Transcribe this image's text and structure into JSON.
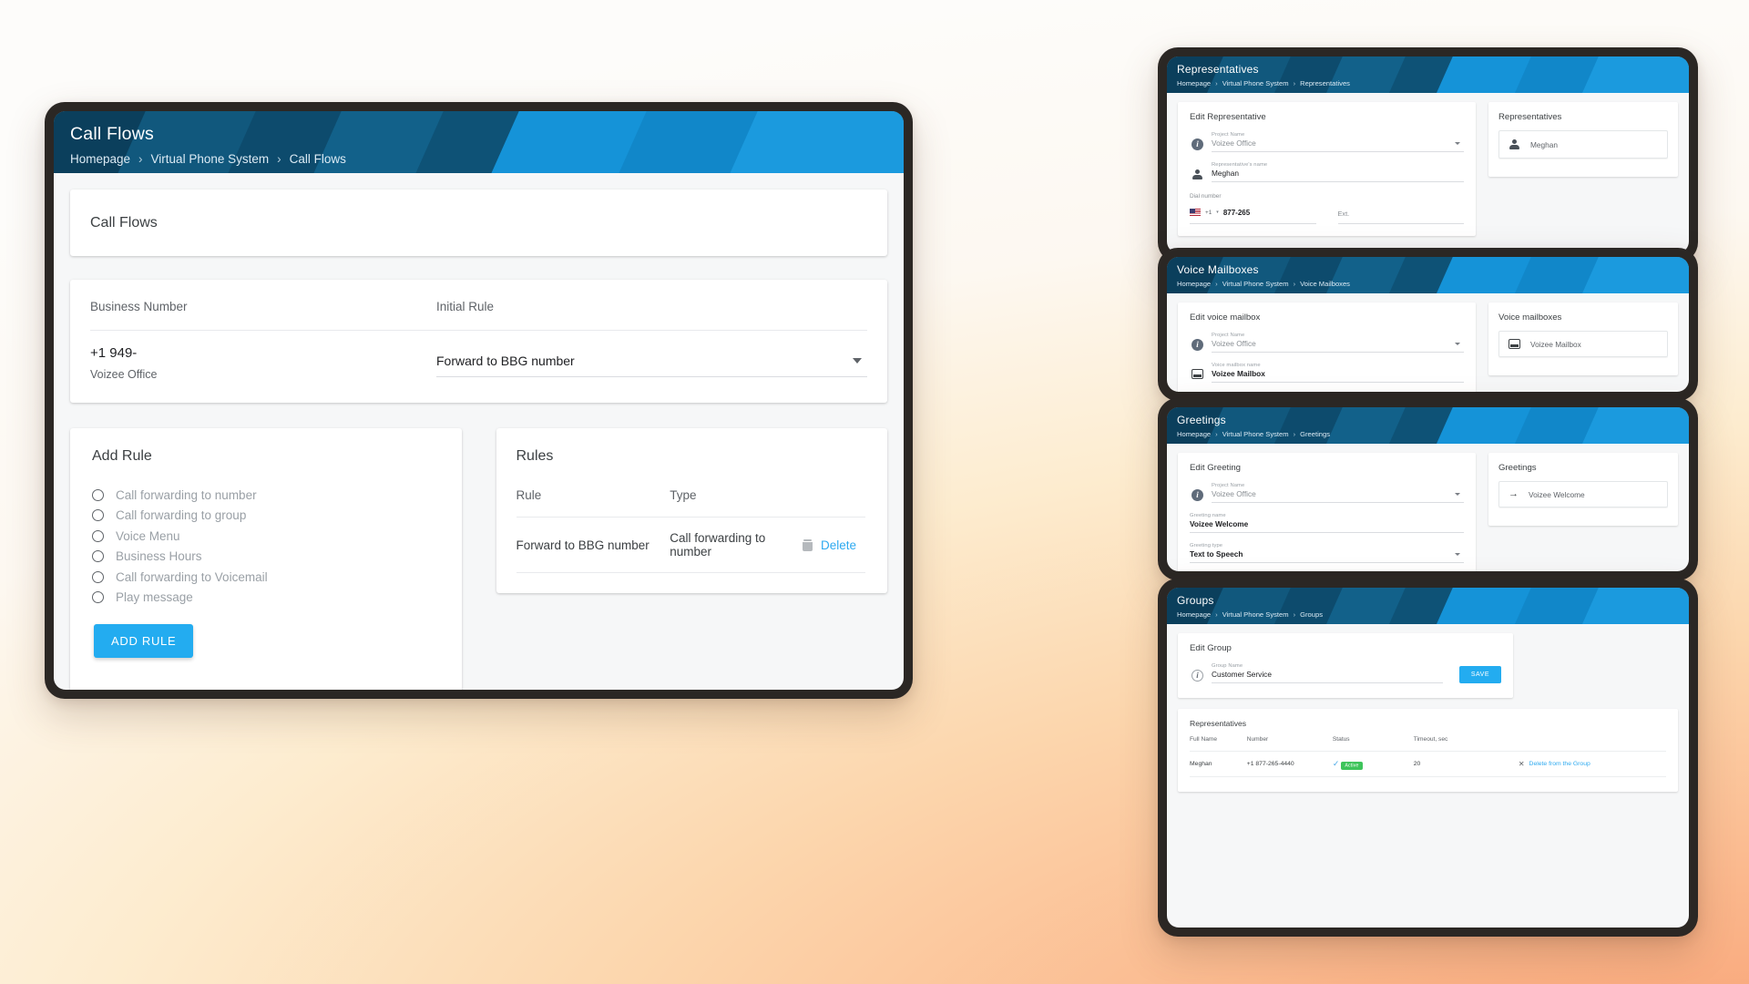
{
  "theme": {
    "accent": "#23acf0",
    "banner_dark": "#0c4a6b",
    "banner_light": "#1593d8",
    "link": "#2eaaf0",
    "status_green": "#3ec45b",
    "bg_warm": "#f79b6e"
  },
  "main": {
    "banner": {
      "title": "Call Flows",
      "breadcrumb": [
        "Homepage",
        "Virtual Phone System",
        "Call Flows"
      ],
      "separator": "›"
    },
    "page_title": "Call Flows",
    "number_section": {
      "col_business_number": "Business Number",
      "col_initial_rule": "Initial Rule",
      "number": "+1 949-",
      "project": "Voizee Office",
      "initial_rule_value": "Forward to BBG number"
    },
    "add_rule": {
      "title": "Add Rule",
      "options": [
        "Call forwarding to number",
        "Call forwarding to group",
        "Voice Menu",
        "Business Hours",
        "Call forwarding to Voicemail",
        "Play message"
      ],
      "button": "ADD RULE"
    },
    "rules": {
      "title": "Rules",
      "columns": [
        "Rule",
        "Type",
        ""
      ],
      "rows": [
        {
          "rule": "Forward to BBG number",
          "type": "Call forwarding to number",
          "action": "Delete"
        }
      ]
    }
  },
  "panels": {
    "representatives": {
      "banner": {
        "title": "Representatives",
        "breadcrumb": [
          "Homepage",
          "Virtual Phone System",
          "Representatives"
        ],
        "separator": "›"
      },
      "form_title": "Edit Representative",
      "fields": [
        {
          "label": "Project Name",
          "value": "Voizee Office",
          "icon": "info-icon"
        },
        {
          "label": "Representative's name",
          "value": "Meghan",
          "icon": "person-icon"
        }
      ],
      "dial_label": "Dial number",
      "dial_prefix": "+1",
      "dial_value": "877-265",
      "ext_label": "Ext.",
      "side_title": "Representatives",
      "side_items": [
        {
          "label": "Meghan",
          "icon": "person-icon"
        }
      ]
    },
    "voice_mailboxes": {
      "banner": {
        "title": "Voice Mailboxes",
        "breadcrumb": [
          "Homepage",
          "Virtual Phone System",
          "Voice Mailboxes"
        ],
        "separator": "›"
      },
      "form_title": "Edit voice mailbox",
      "fields": [
        {
          "label": "Project Name",
          "value": "Voizee Office",
          "icon": "info-icon"
        },
        {
          "label": "Voice mailbox name",
          "value": "Voizee Mailbox",
          "icon": "mailbox-icon"
        }
      ],
      "side_title": "Voice mailboxes",
      "side_items": [
        {
          "label": "Voizee Mailbox",
          "icon": "mailbox-icon"
        }
      ]
    },
    "greetings": {
      "banner": {
        "title": "Greetings",
        "breadcrumb": [
          "Homepage",
          "Virtual Phone System",
          "Greetings"
        ],
        "separator": "›"
      },
      "form_title": "Edit Greeting",
      "fields": [
        {
          "label": "Project Name",
          "value": "Voizee Office",
          "icon": "info-icon"
        },
        {
          "label": "Greeting name",
          "value": "Voizee Welcome",
          "icon": "none"
        },
        {
          "label": "Greeting type",
          "value": "Text to Speech",
          "icon": "none"
        }
      ],
      "side_title": "Greetings",
      "side_items": [
        {
          "label": "Voizee Welcome",
          "icon": "arrow-right-icon"
        }
      ]
    },
    "groups": {
      "banner": {
        "title": "Groups",
        "breadcrumb": [
          "Homepage",
          "Virtual Phone System",
          "Groups"
        ],
        "separator": "›"
      },
      "form_title": "Edit Group",
      "group_name_label": "Group Name",
      "group_name_value": "Customer Service",
      "save_label": "SAVE",
      "reps_title": "Representatives",
      "reps_columns": [
        "Full Name",
        "Number",
        "Status",
        "Timeout, sec",
        ""
      ],
      "reps_rows": [
        {
          "full_name": "Meghan",
          "number": "+1 877-265-4440",
          "status": "Active",
          "timeout": "20",
          "action": "Delete from the Group"
        }
      ]
    }
  }
}
